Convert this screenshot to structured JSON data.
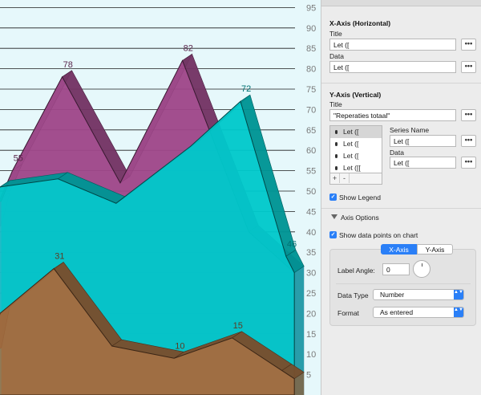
{
  "chart_data": {
    "type": "area",
    "x_visible_range": [
      0,
      7
    ],
    "ylim": [
      0,
      100
    ],
    "y_ticks": [
      5,
      10,
      15,
      20,
      25,
      30,
      35,
      40,
      45,
      50,
      55,
      60,
      65,
      70,
      75,
      80,
      85,
      90,
      95
    ],
    "y_tick_labels": [
      "5",
      "10",
      "15",
      "20",
      "25",
      "30",
      "35",
      "40",
      "45",
      "50",
      "55",
      "60",
      "65",
      "70",
      "75",
      "80",
      "85",
      "90",
      "95"
    ],
    "series": [
      {
        "color": "#a2488c",
        "x": [
          -0.2,
          0,
          0.3,
          1.5,
          2.9,
          4.4,
          6.0,
          7.1
        ],
        "values": [
          40,
          48,
          55,
          78,
          52,
          82,
          40,
          30
        ],
        "data_labels": [
          null,
          null,
          "55",
          "78",
          "",
          "82",
          null,
          null
        ]
      },
      {
        "color": "#00cdcf",
        "x": [
          -0.2,
          0,
          1.4,
          2.8,
          4.6,
          5.8,
          6.9,
          7.1
        ],
        "values": [
          46,
          51,
          53,
          47,
          61,
          72,
          34,
          30
        ],
        "data_labels": [
          null,
          null,
          "",
          "",
          "",
          "72",
          "46",
          null
        ]
      },
      {
        "color": "#a96c3e",
        "x": [
          -0.2,
          0,
          1.3,
          2.7,
          4.2,
          5.6,
          6.8,
          7.1
        ],
        "values": [
          10,
          20,
          31,
          12,
          9,
          14,
          6,
          4
        ],
        "data_labels": [
          null,
          null,
          "31",
          "",
          "10",
          "15",
          "",
          null
        ]
      }
    ]
  },
  "panel": {
    "x_axis": {
      "header": "X-Axis (Horizontal)",
      "title_label": "Title",
      "title_value": "Let ([",
      "data_label": "Data",
      "data_value": "Let ([",
      "button_glyph": "•••"
    },
    "y_axis": {
      "header": "Y-Axis (Vertical)",
      "title_label": "Title",
      "title_value": "\"Reperaties totaal\"",
      "button_glyph": "•••",
      "series_items": [
        "Let ([",
        "Let ([",
        "Let ([",
        "Let ([["
      ],
      "series_name_label": "Series Name",
      "series_name_value": "Let ([",
      "data_label": "Data",
      "data_value": "Let ([",
      "add_glyph": "+",
      "remove_glyph": "-"
    },
    "show_legend": "Show Legend",
    "axis_options": {
      "header": "Axis Options",
      "show_points": "Show data points on chart",
      "tab_x": "X-Axis",
      "tab_y": "Y-Axis",
      "label_angle_label": "Label Angle:",
      "label_angle_value": "0",
      "data_type_label": "Data Type",
      "data_type_value": "Number",
      "format_label": "Format",
      "format_value": "As entered"
    },
    "check_glyph": "✓",
    "popup_arrows": "▲▼"
  },
  "colors": {
    "accent": "#2a7ff7",
    "chart_background": "#e6f8fb",
    "grid": "#1c1c1c",
    "tick_text": "#7a7a7a"
  }
}
